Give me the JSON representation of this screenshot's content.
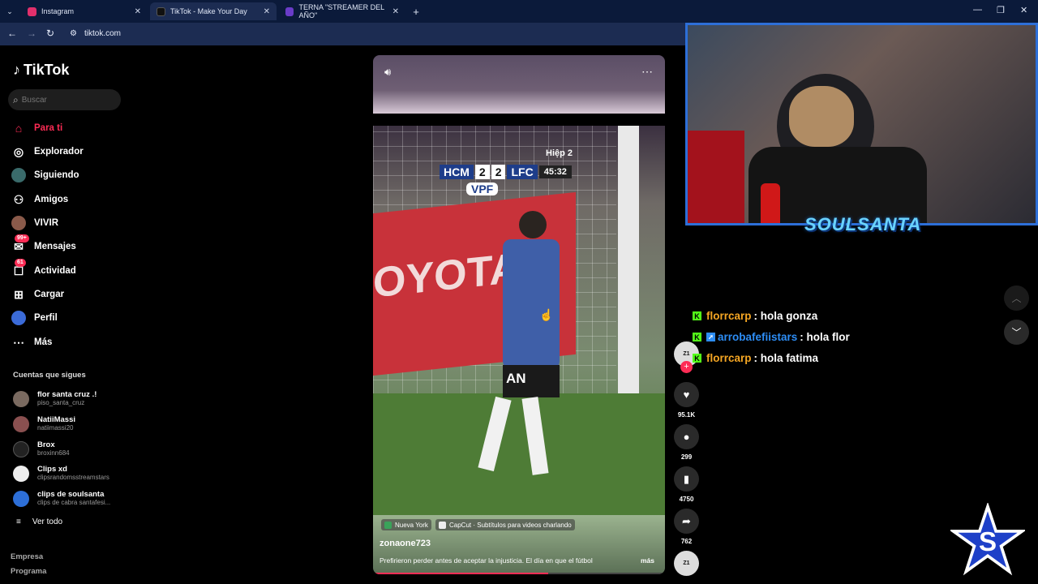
{
  "browser": {
    "tabs": [
      {
        "label": "Instagram",
        "color": "#e1306c"
      },
      {
        "label": "TikTok - Make Your Day",
        "color": "#000000"
      },
      {
        "label": "TERNA \"STREAMER DEL AÑO\"",
        "color": "#6a3cc8"
      }
    ],
    "url": "tiktok.com"
  },
  "sidebar": {
    "logo": "TikTok",
    "search_placeholder": "Buscar",
    "nav": [
      {
        "label": "Para ti",
        "icon": "home-icon",
        "active": true
      },
      {
        "label": "Explorador",
        "icon": "compass-icon"
      },
      {
        "label": "Siguiendo",
        "icon": "following-icon"
      },
      {
        "label": "Amigos",
        "icon": "friends-icon"
      },
      {
        "label": "VIVIR",
        "icon": "live-icon"
      },
      {
        "label": "Mensajes",
        "icon": "messages-icon",
        "badge": "99+"
      },
      {
        "label": "Actividad",
        "icon": "activity-icon",
        "badge": "61"
      },
      {
        "label": "Cargar",
        "icon": "upload-icon"
      },
      {
        "label": "Perfil",
        "icon": "profile-icon"
      },
      {
        "label": "Más",
        "icon": "more-icon"
      }
    ],
    "following_title": "Cuentas que sigues",
    "following": [
      {
        "name": "flor santa cruz .!",
        "handle": "piso_santa_cruz"
      },
      {
        "name": "NatiiMassi",
        "handle": "natiimassi20"
      },
      {
        "name": "Brox",
        "handle": "broxinn684"
      },
      {
        "name": "Clips xd",
        "handle": "clipsrandomsstreamstars"
      },
      {
        "name": "clips de soulsanta",
        "handle": "clips de cabra santafesi..."
      }
    ],
    "see_all": "Ver todo",
    "footer": [
      "Empresa",
      "Programa"
    ]
  },
  "video": {
    "chips": [
      "Nueva York",
      "CapCut · Subtítulos para videos charlando"
    ],
    "username": "zonaone723",
    "description": "Prefirieron perder antes de aceptar la injusticia. El día en que el fútbol",
    "more": "más",
    "progress": 0.6,
    "scoreboard": {
      "home": "HCM",
      "home_score": "2",
      "away_score": "2",
      "away": "LFC",
      "half": "Hiệp 2",
      "time": "45:32",
      "broadcaster": "VPF"
    },
    "overlay_text": "AN"
  },
  "actions": {
    "likes": "95.1K",
    "comments": "299",
    "saves": "4750",
    "shares": "762"
  },
  "stream": {
    "overlay_name": "SOULSANTA",
    "chat": [
      {
        "user": "florrcarp",
        "message": ": hola gonza",
        "user_color": "#f5a623"
      },
      {
        "user": "arrobafefiistars",
        "message": ": hola flor",
        "user_color": "#2d8df5"
      },
      {
        "user": "florrcarp",
        "message": ": hola fatima",
        "user_color": "#f5a623"
      }
    ]
  }
}
